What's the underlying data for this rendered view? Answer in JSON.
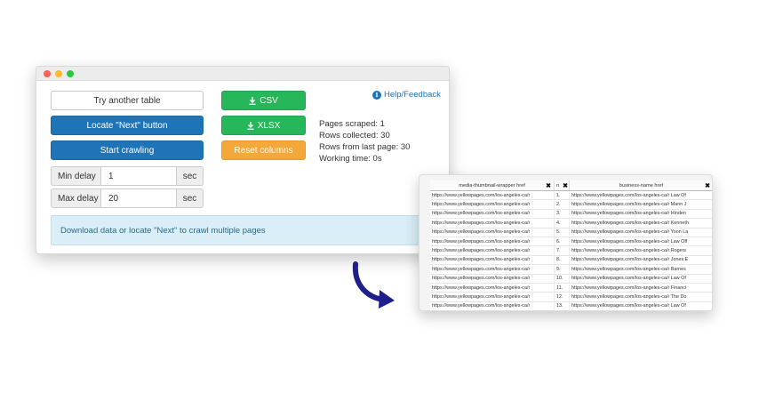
{
  "window": {
    "buttons": {
      "try_another": "Try another table",
      "locate_next": "Locate \"Next\" button",
      "start_crawling": "Start crawling",
      "csv": "CSV",
      "xlsx": "XLSX",
      "reset_columns": "Reset columns"
    },
    "delays": {
      "min_label": "Min delay",
      "min_value": "1",
      "max_label": "Max delay",
      "max_value": "20",
      "unit": "sec"
    },
    "stats": {
      "pages_scraped": "Pages scraped: 1",
      "rows_collected": "Rows collected: 30",
      "rows_last_page": "Rows from last page: 30",
      "working_time": "Working time: 0s"
    },
    "help": "Help/Feedback",
    "info": "Download data or locate \"Next\" to crawl multiple pages"
  },
  "table": {
    "headers": [
      "media-thumbnail-wrapper href",
      "n",
      "business-name href"
    ],
    "rows": [
      [
        "https://www.yellowpages.com/los-angeles-ca/r",
        "1.",
        "https://www.yellowpages.com/los-angeles-ca/r Law Of"
      ],
      [
        "https://www.yellowpages.com/los-angeles-ca/r",
        "2.",
        "https://www.yellowpages.com/los-angeles-ca/r Mann J"
      ],
      [
        "https://www.yellowpages.com/los-angeles-ca/r",
        "3.",
        "https://www.yellowpages.com/los-angeles-ca/r Hinden"
      ],
      [
        "https://www.yellowpages.com/los-angeles-ca/r",
        "4.",
        "https://www.yellowpages.com/los-angeles-ca/r Kenneth"
      ],
      [
        "https://www.yellowpages.com/los-angeles-ca/r",
        "5.",
        "https://www.yellowpages.com/los-angeles-ca/r Yoon La"
      ],
      [
        "https://www.yellowpages.com/los-angeles-ca/r",
        "6.",
        "https://www.yellowpages.com/los-angeles-ca/r Law Off"
      ],
      [
        "https://www.yellowpages.com/los-angeles-ca/r",
        "7.",
        "https://www.yellowpages.com/los-angeles-ca/r Rogers"
      ],
      [
        "https://www.yellowpages.com/los-angeles-ca/r",
        "8.",
        "https://www.yellowpages.com/los-angeles-ca/r Jones E"
      ],
      [
        "https://www.yellowpages.com/los-angeles-ca/r",
        "9.",
        "https://www.yellowpages.com/los-angeles-ca/r Barnes"
      ],
      [
        "https://www.yellowpages.com/los-angeles-ca/r",
        "10.",
        "https://www.yellowpages.com/los-angeles-ca/r Law Of"
      ],
      [
        "https://www.yellowpages.com/los-angeles-ca/r",
        "11.",
        "https://www.yellowpages.com/los-angeles-ca/r Financi"
      ],
      [
        "https://www.yellowpages.com/los-angeles-ca/r",
        "12.",
        "https://www.yellowpages.com/los-angeles-ca/r The Do"
      ],
      [
        "https://www.yellowpages.com/los-angeles-ca/r",
        "13.",
        "https://www.yellowpages.com/los-angeles-ca/r Law Of"
      ]
    ]
  },
  "colors": {
    "blue": "#1f73b7",
    "green": "#28b65a",
    "orange": "#f5a83a",
    "arrow": "#1f1f8c"
  }
}
